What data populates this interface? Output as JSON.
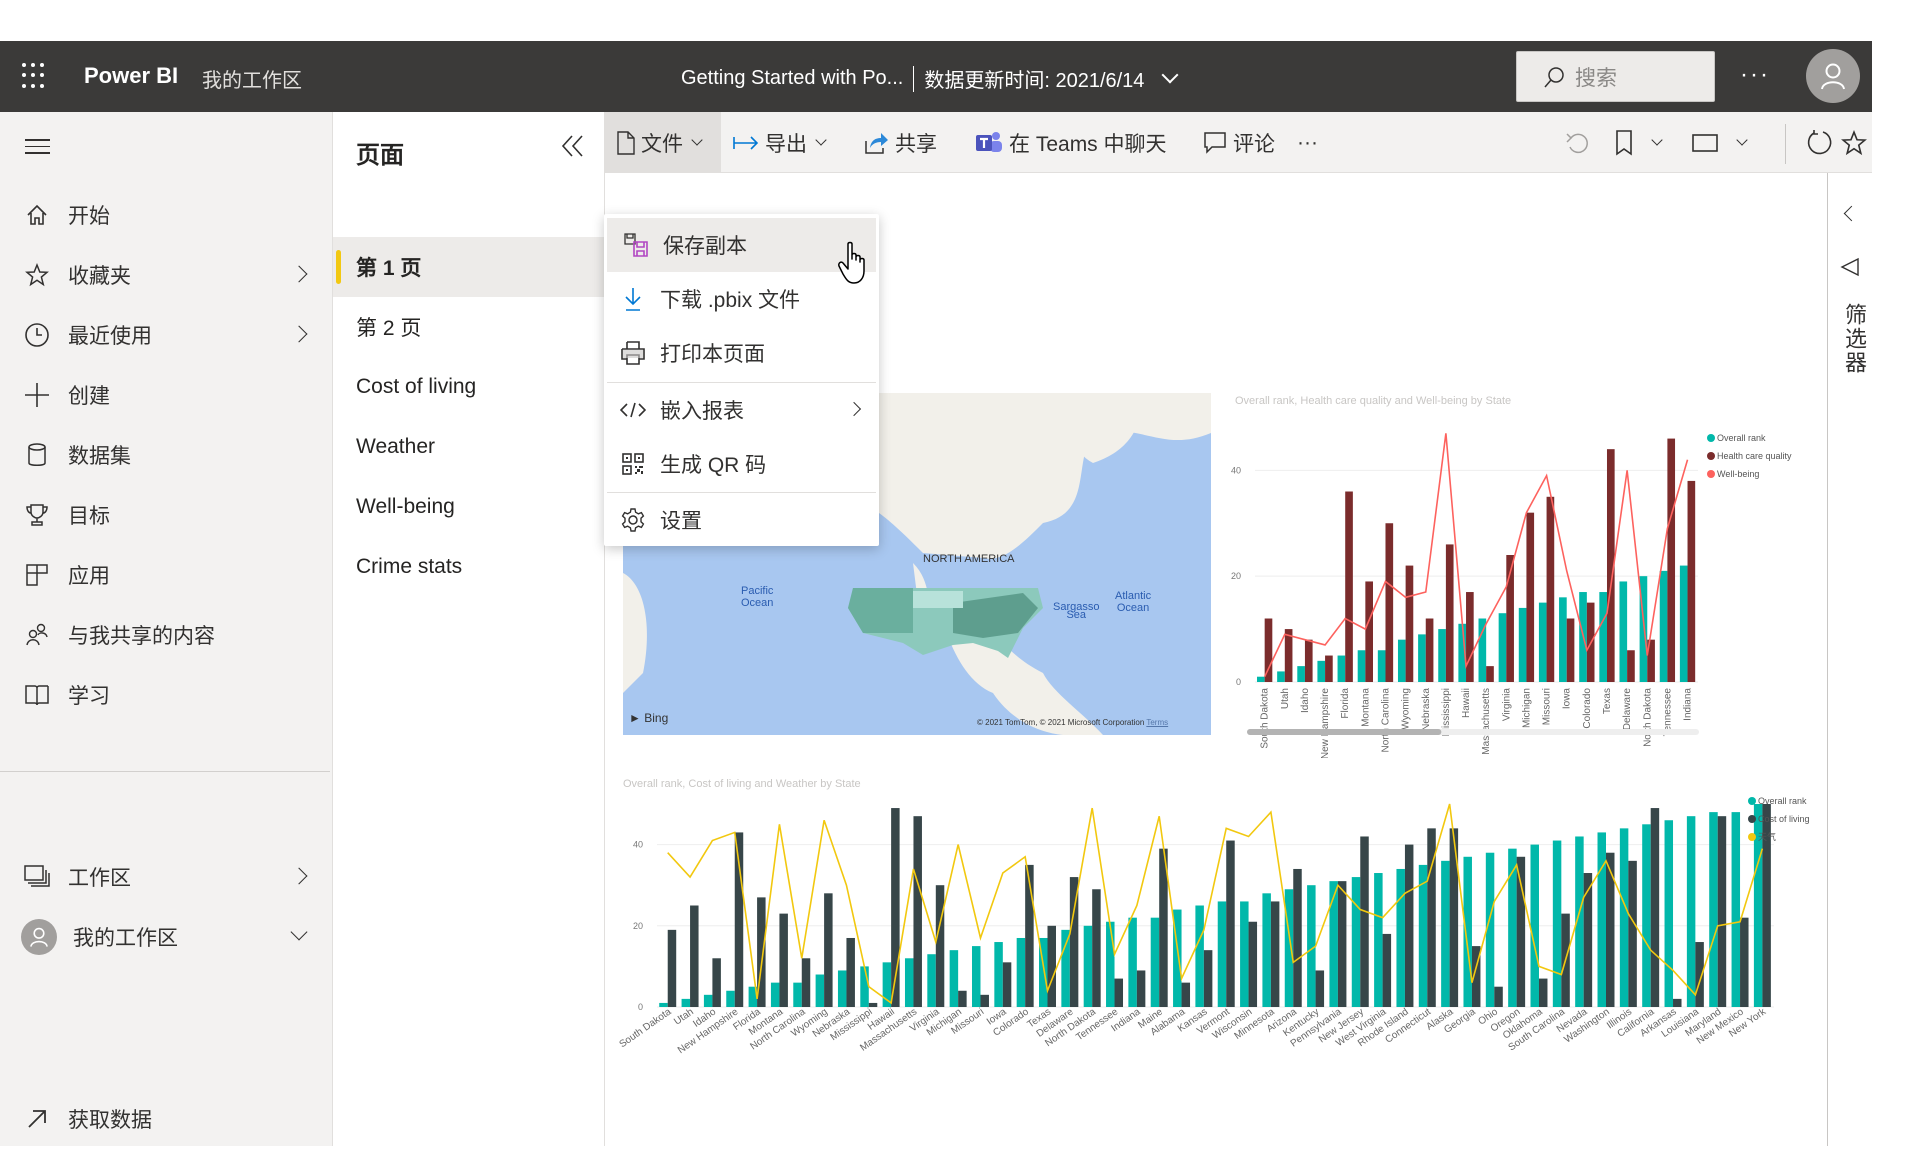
{
  "header": {
    "app_name": "Power BI",
    "workspace": "我的工作区",
    "report_title": "Getting Started with Po...",
    "refresh_label": "数据更新时间: 2021/6/14",
    "search_placeholder": "搜索",
    "more_label": "···"
  },
  "nav": {
    "items": [
      {
        "label": "开始",
        "icon": "home-icon"
      },
      {
        "label": "收藏夹",
        "icon": "star-icon",
        "chevron": true
      },
      {
        "label": "最近使用",
        "icon": "clock-icon",
        "chevron": true
      },
      {
        "label": "创建",
        "icon": "plus-icon"
      },
      {
        "label": "数据集",
        "icon": "database-icon"
      },
      {
        "label": "目标",
        "icon": "trophy-icon"
      },
      {
        "label": "应用",
        "icon": "apps-icon"
      },
      {
        "label": "与我共享的内容",
        "icon": "shared-icon"
      },
      {
        "label": "学习",
        "icon": "book-icon"
      }
    ],
    "workspaces_label": "工作区",
    "my_workspace_label": "我的工作区",
    "get_data_label": "获取数据"
  },
  "pages": {
    "title": "页面",
    "items": [
      "第 1 页",
      "第 2 页",
      "Cost of living",
      "Weather",
      "Well-being",
      "Crime stats"
    ],
    "active_index": 0
  },
  "toolbar": {
    "file": "文件",
    "export": "导出",
    "share": "共享",
    "teams": "在 Teams 中聊天",
    "comment": "评论",
    "more": "···"
  },
  "file_menu": {
    "items": [
      {
        "label": "保存副本",
        "icon": "save-copy-icon"
      },
      {
        "label": "下载 .pbix 文件",
        "icon": "download-icon"
      },
      {
        "label": "打印本页面",
        "icon": "print-icon"
      },
      {
        "label": "嵌入报表",
        "icon": "embed-code-icon",
        "submenu": true
      },
      {
        "label": "生成 QR 码",
        "icon": "qr-code-icon"
      },
      {
        "label": "设置",
        "icon": "settings-icon"
      }
    ],
    "hovered_index": 0
  },
  "filters_pane": {
    "label": "筛选器"
  },
  "map": {
    "labels": {
      "continent": "NORTH AMERICA",
      "pacific": "Pacific\nOcean",
      "atlantic": "Atlantic\nOcean",
      "sargasso": "Sargasso\nSea",
      "provider": "Bing",
      "copyright": "© 2021 TomTom, © 2021 Microsoft Corporation",
      "terms": "Terms"
    }
  },
  "colors": {
    "overall_rank": "#01b8aa",
    "health_care": "#7b2c2c",
    "well_being": "#fd625e",
    "cost_of_living": "#374649",
    "weather": "#f2c80f",
    "accent": "#f2c811"
  },
  "chart_data": [
    {
      "type": "bar",
      "title": "Overall rank, Health care quality and Well-being by State",
      "xlabel": "",
      "ylabel": "",
      "ylim": [
        0,
        48
      ],
      "yticks": [
        0,
        20,
        40
      ],
      "grid": true,
      "legend": "top-right",
      "categories": [
        "South Dakota",
        "Utah",
        "Idaho",
        "New Hampshire",
        "Florida",
        "Montana",
        "North Carolina",
        "Wyoming",
        "Nebraska",
        "Mississippi",
        "Hawaii",
        "Massachusetts",
        "Virginia",
        "Michigan",
        "Missouri",
        "Iowa",
        "Colorado",
        "Texas",
        "Delaware",
        "North Dakota",
        "Tennessee",
        "Indiana"
      ],
      "series": [
        {
          "name": "Overall rank",
          "kind": "bar",
          "values": [
            1,
            2,
            3,
            4,
            5,
            6,
            6,
            8,
            9,
            10,
            11,
            12,
            13,
            14,
            15,
            16,
            17,
            17,
            19,
            20,
            21,
            22
          ]
        },
        {
          "name": "Health care quality",
          "kind": "bar",
          "values": [
            12,
            10,
            8,
            5,
            36,
            19,
            30,
            22,
            12,
            26,
            17,
            3,
            24,
            32,
            35,
            12,
            15,
            44,
            6,
            8,
            46,
            38
          ]
        },
        {
          "name": "Well-being",
          "kind": "line",
          "values": [
            1,
            9,
            8,
            7,
            12,
            10,
            19,
            16,
            17,
            47,
            3,
            11,
            18,
            32,
            39,
            21,
            6,
            13,
            40,
            5,
            29,
            42
          ]
        }
      ],
      "scroll_fraction_visible": 0.43
    },
    {
      "type": "bar",
      "title": "Overall rank, Cost of living and Weather by State",
      "xlabel": "",
      "ylabel": "",
      "ylim": [
        0,
        50
      ],
      "yticks": [
        0,
        20,
        40
      ],
      "grid": true,
      "legend": "top-right",
      "categories": [
        "South Dakota",
        "Utah",
        "Idaho",
        "New Hampshire",
        "Florida",
        "Montana",
        "North Carolina",
        "Wyoming",
        "Nebraska",
        "Mississippi",
        "Hawaii",
        "Massachusetts",
        "Virginia",
        "Michigan",
        "Missouri",
        "Iowa",
        "Colorado",
        "Texas",
        "Delaware",
        "North Dakota",
        "Tennessee",
        "Indiana",
        "Maine",
        "Alabama",
        "Kansas",
        "Vermont",
        "Wisconsin",
        "Minnesota",
        "Arizona",
        "Kentucky",
        "Pennsylvania",
        "New Jersey",
        "West Virginia",
        "Rhode Island",
        "Connecticut",
        "Alaska",
        "Georgia",
        "Ohio",
        "Oregon",
        "Oklahoma",
        "South Carolina",
        "Nevada",
        "Washington",
        "Illinois",
        "California",
        "Arkansas",
        "Louisiana",
        "Maryland",
        "New Mexico",
        "New York"
      ],
      "series": [
        {
          "name": "Overall rank",
          "kind": "bar",
          "values": [
            1,
            2,
            3,
            4,
            5,
            6,
            6,
            8,
            9,
            10,
            11,
            12,
            13,
            14,
            15,
            16,
            17,
            17,
            19,
            20,
            21,
            22,
            22,
            24,
            25,
            26,
            26,
            28,
            29,
            30,
            31,
            32,
            33,
            34,
            35,
            36,
            37,
            38,
            39,
            40,
            41,
            42,
            43,
            44,
            45,
            46,
            47,
            48,
            48,
            50
          ]
        },
        {
          "name": "Cost of living",
          "kind": "bar",
          "values": [
            19,
            25,
            12,
            43,
            27,
            23,
            12,
            28,
            17,
            1,
            49,
            47,
            30,
            4,
            3,
            11,
            35,
            20,
            32,
            29,
            7,
            9,
            39,
            6,
            14,
            41,
            21,
            26,
            34,
            9,
            31,
            42,
            18,
            40,
            44,
            44,
            15,
            5,
            37,
            7,
            23,
            33,
            38,
            36,
            49,
            2,
            16,
            47,
            22,
            50
          ]
        },
        {
          "name": "天气",
          "kind": "line",
          "values": [
            38,
            32,
            41,
            43,
            2,
            45,
            12,
            46,
            30,
            5,
            1,
            34,
            16,
            40,
            17,
            33,
            37,
            4,
            18,
            49,
            13,
            25,
            47,
            7,
            19,
            44,
            42,
            48,
            11,
            15,
            30,
            24,
            22,
            28,
            31,
            50,
            6,
            26,
            35,
            10,
            8,
            27,
            36,
            23,
            14,
            9,
            3,
            20,
            21,
            39
          ]
        }
      ]
    }
  ]
}
